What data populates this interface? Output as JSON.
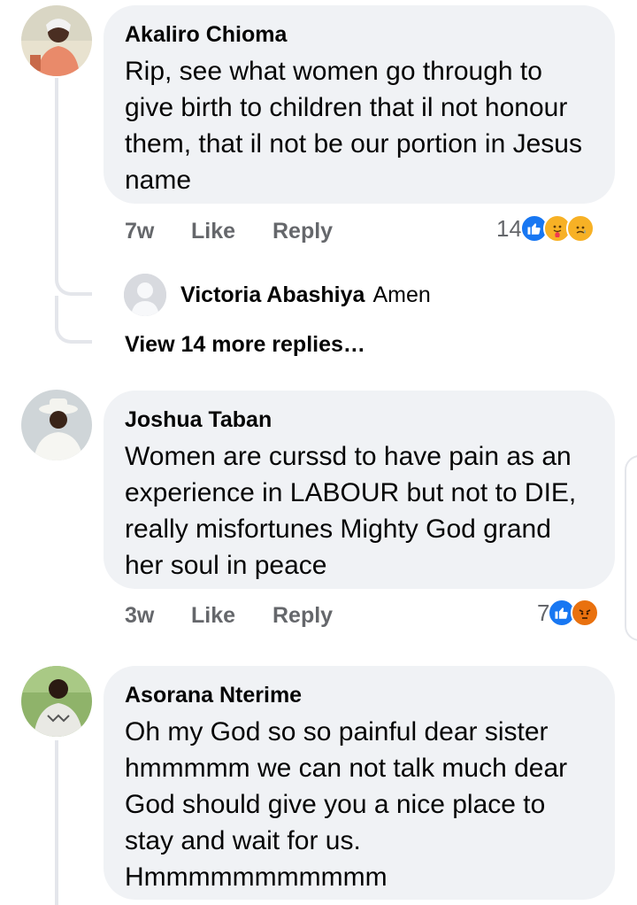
{
  "comments": [
    {
      "author": "Akaliro Chioma",
      "text": "Rip, see what women go through to give birth to children that il not honour them, that il not be our portion in Jesus name",
      "time": "7w",
      "like_label": "Like",
      "reply_label": "Reply",
      "reaction_count": "14",
      "reactions": [
        "like",
        "care",
        "sad"
      ],
      "reply": {
        "author": "Victoria Abashiya",
        "text": "Amen"
      },
      "view_more": "View 14 more replies…"
    },
    {
      "author": "Joshua Taban",
      "text": "Women are curssd to have pain as an experience in LABOUR but not to DIE, really misfortunes Mighty God grand her soul in peace",
      "time": "3w",
      "like_label": "Like",
      "reply_label": "Reply",
      "reaction_count": "7",
      "reactions": [
        "like",
        "angry"
      ]
    },
    {
      "author": "Asorana Nterime",
      "text": "Oh my God so so painful dear sister hmmmmm we can not talk much dear God should give you a nice place to stay and wait for us. Hmmmmmmmmmmm"
    }
  ],
  "colors": {
    "bubble": "#f0f2f5",
    "secondary_text": "#65676b",
    "like_blue": "#1877f2",
    "care_yellow": "#f7b125",
    "angry_orange": "#e9710f"
  }
}
